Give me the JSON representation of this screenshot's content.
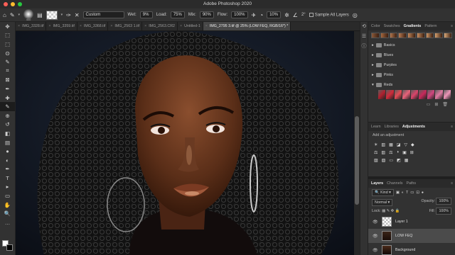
{
  "window": {
    "title": "Adobe Photoshop 2020"
  },
  "colors": {
    "accent": "#2f7ee0",
    "panel_bg": "#323232"
  },
  "options_bar": {
    "brush_size": "400",
    "mode": "Custom",
    "wet_label": "Wet:",
    "wet_value": "9%",
    "load_label": "Load:",
    "load_value": "75%",
    "mix_label": "Mix:",
    "mix_value": "90%",
    "flow_label": "Flow:",
    "flow_value": "100%",
    "pressure_value": "10%",
    "angle_value": "2°",
    "sample_all_layers": "Sample All Layers"
  },
  "tools": [
    "move-icon",
    "artboard-icon",
    "marquee-icon",
    "lasso-icon",
    "quick-select-icon",
    "crop-icon",
    "frame-icon",
    "eyedropper-icon",
    "healing-icon",
    "brush-icon",
    "clone-stamp-icon",
    "history-brush-icon",
    "eraser-icon",
    "gradient-icon",
    "blur-icon",
    "dodge-icon",
    "pen-icon",
    "type-icon",
    "path-select-icon",
    "rectangle-icon",
    "hand-icon",
    "zoom-icon",
    "more-icon"
  ],
  "tool_glyphs": [
    "✥",
    "⬚",
    "⬚",
    "ʘ",
    "✎",
    "⌗",
    "⊠",
    "✒",
    "✚",
    "✎",
    "⊕",
    "↺",
    "◧",
    "▤",
    "●",
    "◐",
    "✒",
    "T",
    "▸",
    "▭",
    "✋",
    "🔍",
    "…"
  ],
  "tabs": [
    {
      "label": "IMG_3328.tif",
      "active": false
    },
    {
      "label": "IMG_3359.tif",
      "active": false
    },
    {
      "label": "IMG_3368.tif",
      "active": false
    },
    {
      "label": "IMG_2563 1.tif",
      "active": false
    },
    {
      "label": "IMG_2563.CR2",
      "active": false
    },
    {
      "label": "Untitled-1",
      "active": false
    },
    {
      "label": "IMG_2795 3.tif @ 25% (LOW FEQ, RGB/16*) *",
      "active": true
    }
  ],
  "gradients_panel": {
    "tabs": [
      "Color",
      "Swatches",
      "Gradients",
      "Pattern"
    ],
    "active_tab": "Gradients",
    "folders": [
      "Basics",
      "Blues",
      "Purples",
      "Pinks",
      "Reds"
    ],
    "swatch_colors": [
      "#8a5a3a",
      "#a4673e",
      "#b2764d",
      "#ba7b52",
      "#c38658",
      "#c98c5c",
      "#cf9664",
      "#d59f6d",
      "#daa877"
    ],
    "red_tiles": [
      "#b0202e",
      "#d12a3a",
      "#e54b55",
      "#e9627a",
      "#d9446a",
      "#c8285a",
      "#d2457e",
      "#e07aa2",
      "#ee95b8"
    ]
  },
  "adjustments_panel": {
    "tabs": [
      "Learn",
      "Libraries",
      "Adjustments"
    ],
    "active_tab": "Adjustments",
    "add_label": "Add an adjustment",
    "row1": [
      "☀",
      "▥",
      "▦",
      "◪",
      "▽",
      "◆"
    ],
    "row2": [
      "⚖",
      "▥",
      "⚖",
      "◑",
      "▣",
      "⊞"
    ],
    "row3": [
      "▨",
      "▧",
      "▭",
      "◩",
      "▦"
    ]
  },
  "layers_panel": {
    "tabs": [
      "Layers",
      "Channels",
      "Paths"
    ],
    "active_tab": "Layers",
    "kind": "Kind",
    "blend_mode": "Normal",
    "opacity_label": "Opacity:",
    "opacity_value": "100%",
    "lock_label": "Lock:",
    "fill_label": "Fill:",
    "fill_value": "100%",
    "layers": [
      {
        "name": "Layer 1",
        "selected": false
      },
      {
        "name": "LOW FEQ",
        "selected": true
      },
      {
        "name": "Background",
        "selected": false
      }
    ]
  }
}
